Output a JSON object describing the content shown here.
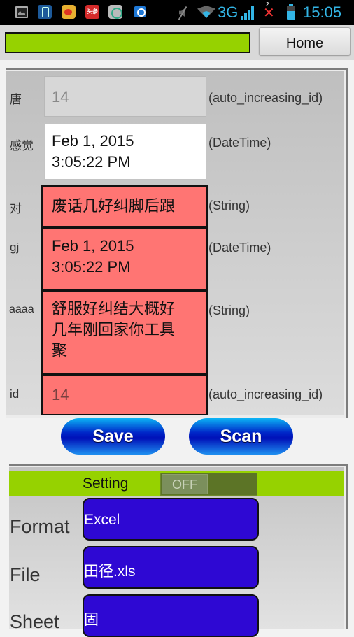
{
  "status_bar": {
    "notification_icons": [
      "gallery-icon",
      "phone-app-icon",
      "weibo-icon",
      "news-app-icon",
      "app-icon",
      "q-app-icon"
    ],
    "news_icon_text": "头条",
    "network": "3G",
    "sim_badge": "2",
    "time": "15:05",
    "accent_color": "#33b5e5"
  },
  "topbar": {
    "progress": 1.0,
    "progress_color": "#96d200",
    "home_label": "Home"
  },
  "record": {
    "fields": [
      {
        "label": "唐",
        "value": "14",
        "type": "(auto_increasing_id)",
        "state": "disabled"
      },
      {
        "label": "感觉",
        "value_line1": "Feb 1, 2015",
        "value_line2": "3:05:22 PM",
        "type": "(DateTime)",
        "state": "normal"
      },
      {
        "label": "对",
        "value": "废话几好纠脚后跟",
        "type": "(String)",
        "state": "highlighted"
      },
      {
        "label": "gj",
        "value_line1": "Feb 1, 2015",
        "value_line2": "3:05:22 PM",
        "type": "(DateTime)",
        "state": "highlighted"
      },
      {
        "label": "aaaa",
        "value_line1": "舒服好纠结大概好",
        "value_line2": "几年刚回家你工具",
        "value_line3": "聚",
        "type": "(String)",
        "state": "highlighted"
      },
      {
        "label": "id",
        "value": "14",
        "type": "(auto_increasing_id)",
        "state": "highlighted"
      }
    ],
    "highlight_color": "#ff7573"
  },
  "actions": {
    "save_label": "Save",
    "scan_label": "Scan"
  },
  "settings": {
    "title": "Setting",
    "toggle_state": "OFF",
    "rows": [
      {
        "label": "Format",
        "value": "Excel"
      },
      {
        "label": "File",
        "value": "田径.xls"
      },
      {
        "label": "Sheet",
        "value": "固"
      }
    ],
    "field_color": "#2e08d3"
  }
}
